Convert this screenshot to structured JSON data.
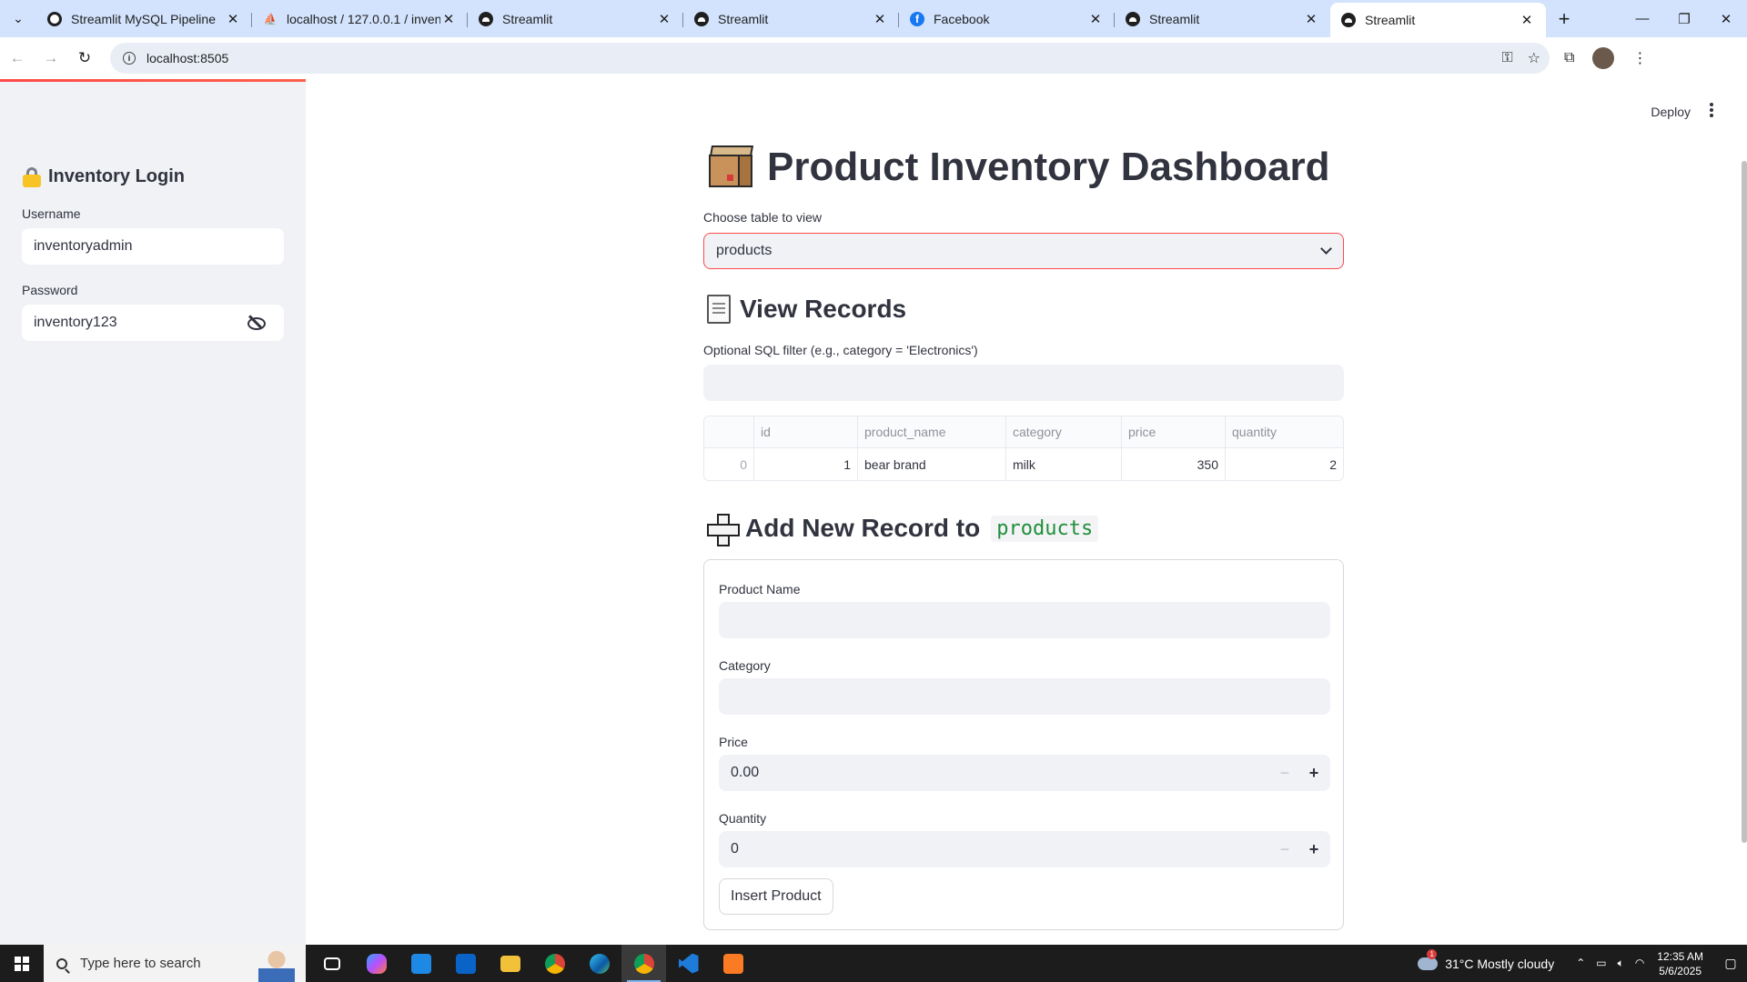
{
  "browser": {
    "tabs": [
      {
        "title": "Streamlit MySQL Pipeline",
        "favicon": "streamlit-circle-icon"
      },
      {
        "title": "localhost / 127.0.0.1 / inventory",
        "favicon": "phpmyadmin-icon"
      },
      {
        "title": "Streamlit",
        "favicon": "streamlit-icon"
      },
      {
        "title": "Streamlit",
        "favicon": "streamlit-icon"
      },
      {
        "title": "Facebook",
        "favicon": "facebook-icon"
      },
      {
        "title": "Streamlit",
        "favicon": "streamlit-icon"
      },
      {
        "title": "Streamlit",
        "favicon": "streamlit-icon",
        "active": true
      }
    ],
    "url": "localhost:8505"
  },
  "sidebar": {
    "title": "Inventory Login",
    "username_label": "Username",
    "username_value": "inventoryadmin",
    "password_label": "Password",
    "password_value": "inventory123"
  },
  "header": {
    "deploy_label": "Deploy"
  },
  "main": {
    "title": "Product Inventory Dashboard",
    "table_select_label": "Choose table to view",
    "table_select_value": "products",
    "view_heading": "View Records",
    "filter_label": "Optional SQL filter (e.g., category = 'Electronics')",
    "filter_value": "",
    "table": {
      "columns": [
        "",
        "id",
        "product_name",
        "category",
        "price",
        "quantity"
      ],
      "rows": [
        [
          "0",
          "1",
          "bear brand",
          "milk",
          "350",
          "2"
        ]
      ]
    },
    "add_heading": "Add New Record to",
    "add_table_name": "products",
    "form": {
      "product_name_label": "Product Name",
      "product_name_value": "",
      "category_label": "Category",
      "category_value": "",
      "price_label": "Price",
      "price_value": "0.00",
      "quantity_label": "Quantity",
      "quantity_value": "0",
      "submit_label": "Insert Product"
    }
  },
  "taskbar": {
    "search_placeholder": "Type here to search",
    "weather": "31°C  Mostly cloudy",
    "time": "12:35 AM",
    "date": "5/6/2025"
  },
  "colors": {
    "accent": "#ff4b4b",
    "sidebar_bg": "#f0f2f6",
    "text": "#31333f",
    "code_green": "#1f8f3a"
  }
}
